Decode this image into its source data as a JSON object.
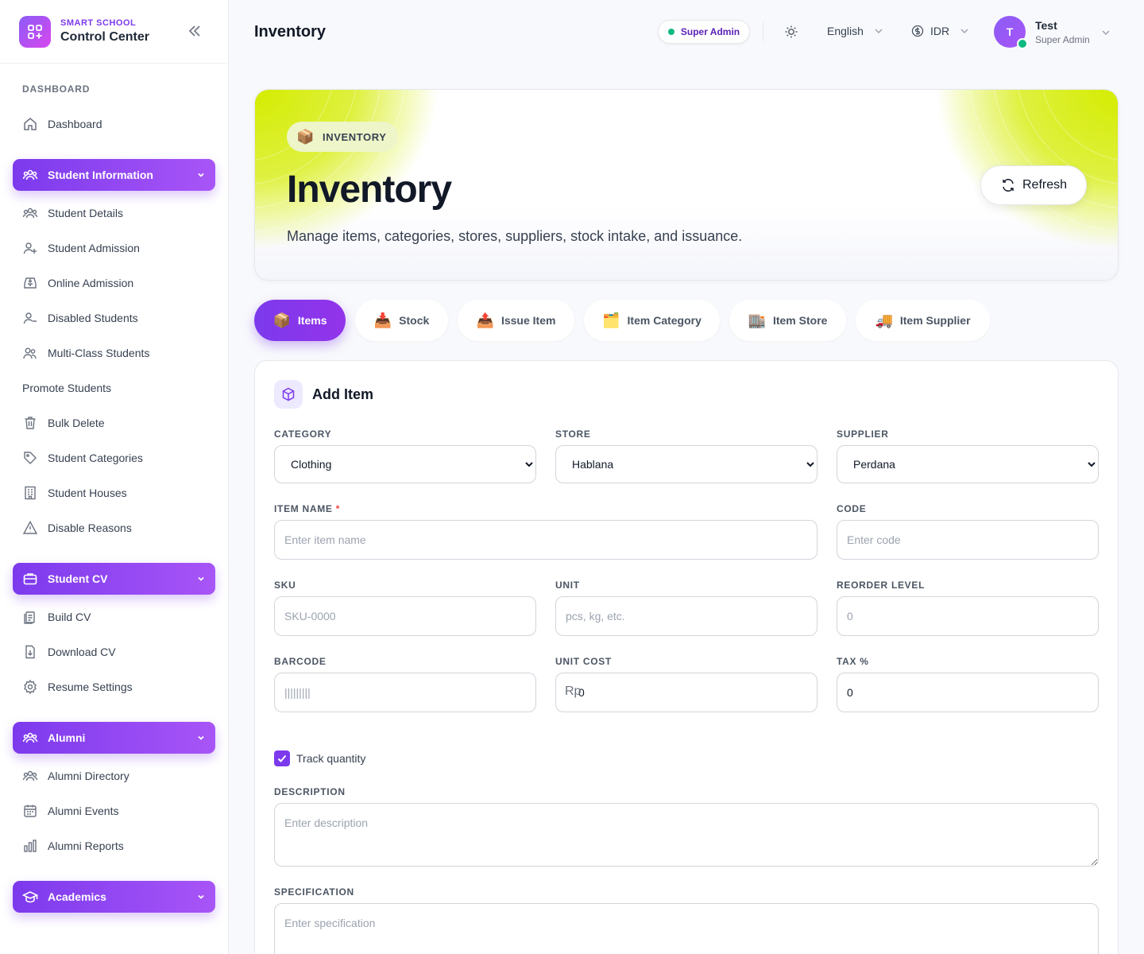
{
  "brand": {
    "small": "SMART SCHOOL",
    "big": "Control Center"
  },
  "sidebar": {
    "section_dashboard": "DASHBOARD",
    "dashboard": "Dashboard",
    "groups": {
      "student_information": "Student Information",
      "student_cv": "Student CV",
      "alumni": "Alumni",
      "academics": "Academics"
    },
    "items": {
      "student_details": "Student Details",
      "student_admission": "Student Admission",
      "online_admission": "Online Admission",
      "disabled_students": "Disabled Students",
      "multi_class_students": "Multi-Class Students",
      "promote_students": "Promote Students",
      "bulk_delete": "Bulk Delete",
      "student_categories": "Student Categories",
      "student_houses": "Student Houses",
      "disable_reasons": "Disable Reasons",
      "build_cv": "Build CV",
      "download_cv": "Download CV",
      "resume_settings": "Resume Settings",
      "alumni_directory": "Alumni Directory",
      "alumni_events": "Alumni Events",
      "alumni_reports": "Alumni Reports"
    }
  },
  "header": {
    "title": "Inventory",
    "role_badge": "Super Admin",
    "language": "English",
    "currency": "IDR",
    "user": {
      "initial": "T",
      "name": "Test",
      "role": "Super Admin"
    }
  },
  "hero": {
    "tag_emoji": "📦",
    "tag": "INVENTORY",
    "title": "Inventory",
    "subtitle": "Manage items, categories, stores, suppliers, stock intake, and issuance.",
    "refresh": "Refresh",
    "accent": "#d4ec00"
  },
  "tabs": [
    {
      "emoji": "📦",
      "label": "Items"
    },
    {
      "emoji": "📥",
      "label": "Stock"
    },
    {
      "emoji": "📤",
      "label": "Issue Item"
    },
    {
      "emoji": "🗂️",
      "label": "Item Category"
    },
    {
      "emoji": "🏬",
      "label": "Item Store"
    },
    {
      "emoji": "🚚",
      "label": "Item Supplier"
    }
  ],
  "form": {
    "title": "Add Item",
    "category": {
      "label": "CATEGORY",
      "value": "Clothing"
    },
    "store": {
      "label": "STORE",
      "value": "Hablana"
    },
    "supplier": {
      "label": "SUPPLIER",
      "value": "Perdana"
    },
    "item_name": {
      "label": "ITEM NAME",
      "required": "*",
      "placeholder": "Enter item name"
    },
    "code": {
      "label": "CODE",
      "placeholder": "Enter code"
    },
    "sku": {
      "label": "SKU",
      "placeholder": "SKU-0000"
    },
    "unit": {
      "label": "UNIT",
      "placeholder": "pcs, kg, etc."
    },
    "reorder_level": {
      "label": "REORDER LEVEL",
      "placeholder": "0"
    },
    "barcode": {
      "label": "BARCODE",
      "placeholder": "|||||||||"
    },
    "unit_cost": {
      "label": "UNIT COST",
      "prefix": "Rp",
      "value": "0"
    },
    "tax": {
      "label": "TAX %",
      "value": "0"
    },
    "track_quantity": "Track quantity",
    "description": {
      "label": "DESCRIPTION",
      "placeholder": "Enter description"
    },
    "specification": {
      "label": "SPECIFICATION",
      "placeholder": "Enter specification"
    }
  }
}
